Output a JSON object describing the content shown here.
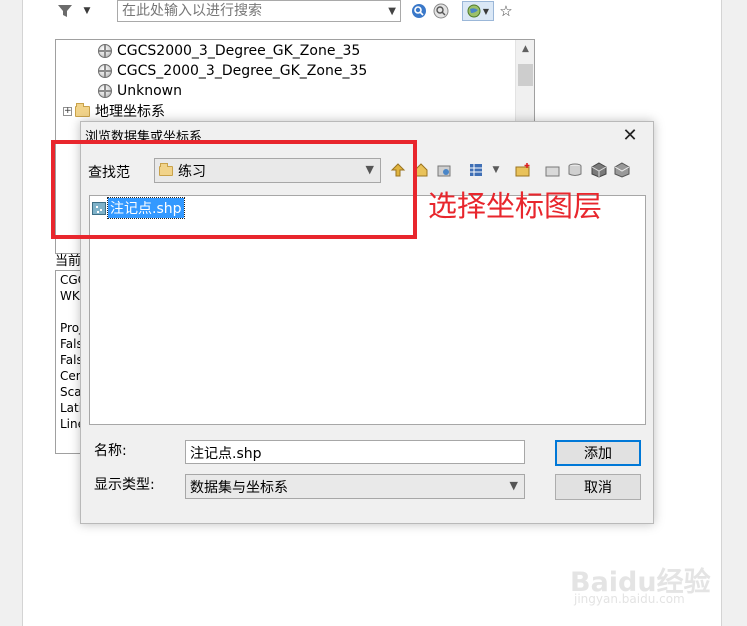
{
  "toolbar": {
    "search_placeholder": "在此处输入以进行搜索",
    "icons": [
      "filter-icon",
      "dropdown-arrow-icon",
      "search-icon",
      "clear-search-icon",
      "globe-icon",
      "favorite-icon"
    ]
  },
  "tree": {
    "items": [
      {
        "label": "CGCS2000_3_Degree_GK_Zone_35",
        "icon": "globe-icon"
      },
      {
        "label": "CGCS_2000_3_Degree_GK_Zone_35",
        "icon": "globe-icon"
      },
      {
        "label": "Unknown",
        "icon": "globe-icon"
      },
      {
        "label": "地理坐标系",
        "icon": "folder-icon",
        "expander": "+"
      }
    ]
  },
  "current": {
    "label": "当前",
    "lines": [
      "CGC",
      "WK",
      "",
      "Proj",
      "Fals",
      "Fals",
      "Cen",
      "Sca",
      "Lati",
      "Line"
    ]
  },
  "dialog": {
    "title": "浏览数据集或坐标系",
    "close": "✕",
    "lookin_label": "查找范",
    "lookin_value": "练习",
    "file_name": "注记点.shp",
    "name_label": "名称:",
    "name_value": "注记点.shp",
    "type_label": "显示类型:",
    "type_value": "数据集与坐标系",
    "add_button": "添加",
    "cancel_button": "取消",
    "tool_icons": [
      "up-folder-icon",
      "home-icon",
      "connect-folder-icon",
      "view-list-icon",
      "new-folder-icon",
      "folder-icon",
      "database-icon",
      "cube-icon",
      "layer-icon"
    ]
  },
  "annotation": {
    "text": "选择坐标图层",
    "color": "#e8262d"
  },
  "watermark": {
    "text": "Baidu经验",
    "url": "jingyan.baidu.com"
  }
}
